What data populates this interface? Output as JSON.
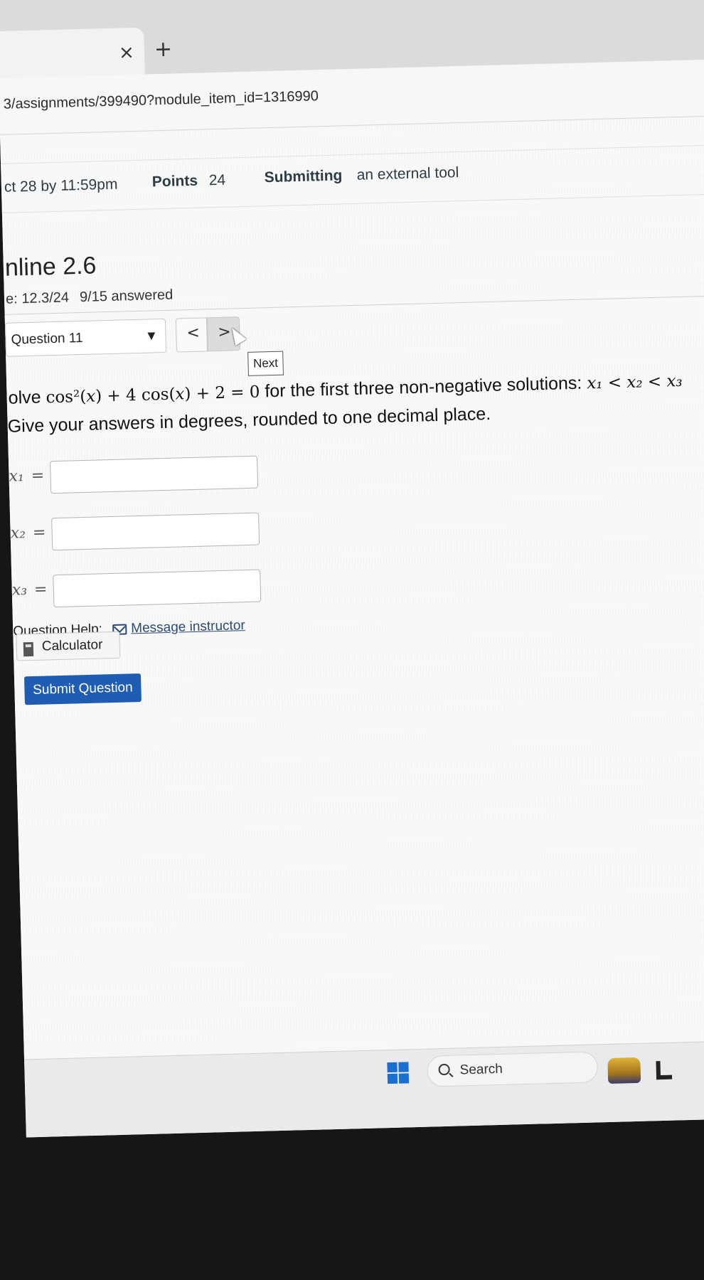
{
  "browser": {
    "tab_close_glyph": "×",
    "new_tab_glyph": "+",
    "url": "3/assignments/399490?module_item_id=1316990"
  },
  "assignment_meta": {
    "due": "ct 28 by 11:59pm",
    "points_label": "Points",
    "points_value": "24",
    "submitting_label": "Submitting",
    "submitting_value": "an external tool"
  },
  "quiz": {
    "title": "nline 2.6",
    "score": "e: 12.3/24",
    "answered": "9/15 answered",
    "question_select": "Question 11",
    "prev_glyph": "<",
    "next_glyph": ">",
    "next_tooltip": "Next",
    "question": {
      "prefix": "olve ",
      "equation": "cos²(𝑥) + 4 cos(𝑥) + 2 = 0",
      "middle": " for the first three non-negative solutions: ",
      "order": "𝑥₁ < 𝑥₂ < 𝑥₃"
    },
    "instructions": "Give your answers in degrees, rounded to one decimal place.",
    "answers": [
      {
        "label": "𝑥₁",
        "eq": "=",
        "value": ""
      },
      {
        "label": "𝑥₂",
        "eq": "=",
        "value": ""
      },
      {
        "label": "𝑥₃",
        "eq": "=",
        "value": ""
      }
    ],
    "help_label": "Question Help:",
    "message_link": "Message instructor",
    "calculator": "Calculator",
    "submit": "Submit Question"
  },
  "taskbar": {
    "search": "Search"
  },
  "colors": {
    "submit_button": "#1f5db4",
    "link": "#2c4a74",
    "windows_blue": "#1a6fd0"
  }
}
